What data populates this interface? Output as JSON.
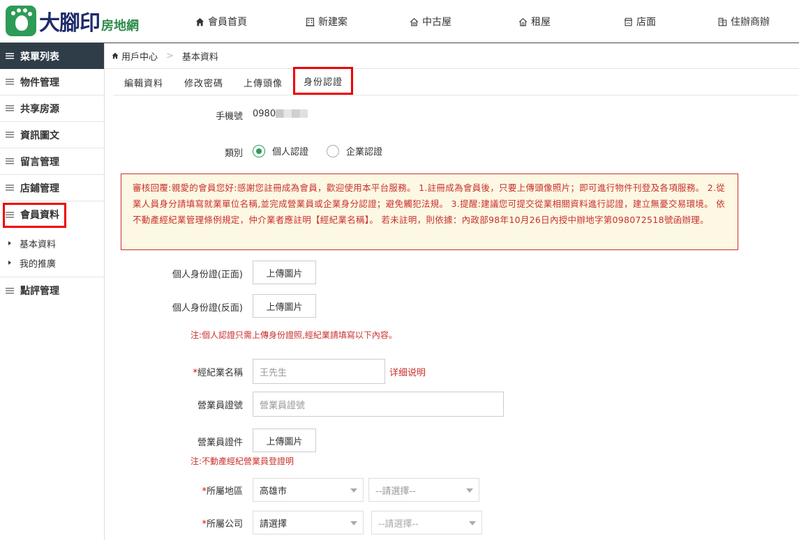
{
  "logo": {
    "main": "大腳印",
    "sub": "房地網"
  },
  "nav": [
    {
      "label": "會員首頁",
      "icon": "home-icon"
    },
    {
      "label": "新建案",
      "icon": "building-icon"
    },
    {
      "label": "中古屋",
      "icon": "house-icon"
    },
    {
      "label": "租屋",
      "icon": "house-icon"
    },
    {
      "label": "店面",
      "icon": "shop-icon"
    },
    {
      "label": "住辦商辦",
      "icon": "office-icon"
    }
  ],
  "sidebar": {
    "title": "菜單列表",
    "items": [
      {
        "label": "物件管理"
      },
      {
        "label": "共享房源"
      },
      {
        "label": "資訊圖文"
      },
      {
        "label": "留言管理"
      },
      {
        "label": "店鋪管理"
      },
      {
        "label": "會員資料"
      }
    ],
    "sub_items": [
      {
        "label": "基本資料"
      },
      {
        "label": "我的推廣"
      }
    ],
    "last_item": {
      "label": "點評管理"
    }
  },
  "breadcrumb": {
    "home": "用戶中心",
    "current": "基本資料"
  },
  "tabs": [
    {
      "label": "編輯資料"
    },
    {
      "label": "修改密碼"
    },
    {
      "label": "上傳頭像"
    },
    {
      "label": "身份認證"
    }
  ],
  "form": {
    "phone": {
      "label": "手機號",
      "value": "0980"
    },
    "category": {
      "label": "類別",
      "option_personal": "個人認證",
      "option_company": "企業認證",
      "selected": "個人認證"
    },
    "notice": "審核回覆:親愛的會員您好:感謝您註冊成為會員，歡迎使用本平台服務。 1.註冊成為會員後，只要上傳頭像照片；即可進行物件刊登及各項服務。 2.從業人員身分請填寫就業單位名稱,並完成營業員或企業身分認證；避免觸犯法規。 3.提醒:建議您可提交從業相關資料進行認證，建立無憂交易環境。 依不動產經紀業管理條例規定，仲介業者應註明【經紀業名稱】。 若未註明，則依據：內政部98年10月26日內授中辦地字第098072518號函辦理。",
    "id_front": {
      "label": "個人身份證(正面)",
      "button": "上傳圖片"
    },
    "id_back": {
      "label": "個人身份證(反面)",
      "button": "上傳圖片"
    },
    "note1": "注:個人認證只需上傳身份證照,經紀業請填寫以下內容。",
    "brokerage": {
      "required": "*",
      "label": "經紀業名稱",
      "placeholder": "王先生",
      "link": "详细说明"
    },
    "agent_id": {
      "label": "營業員證號",
      "placeholder": "營業員證號"
    },
    "agent_doc": {
      "label": "營業員證件",
      "button": "上傳圖片"
    },
    "note2": "注:不動產經紀營業員登證明",
    "region": {
      "required": "*",
      "label": "所屬地區",
      "city": "高雄市",
      "district": "--請選擇--"
    },
    "company": {
      "required": "*",
      "label": "所屬公司",
      "value1": "請選擇",
      "value2": "--請選擇--"
    }
  },
  "colors": {
    "brand_green": "#2e9b57",
    "sidebar_dark": "#2f3d48",
    "highlight_red": "#ee0000",
    "notice_text": "#c9302c",
    "notice_bg": "#fcf8e3"
  }
}
